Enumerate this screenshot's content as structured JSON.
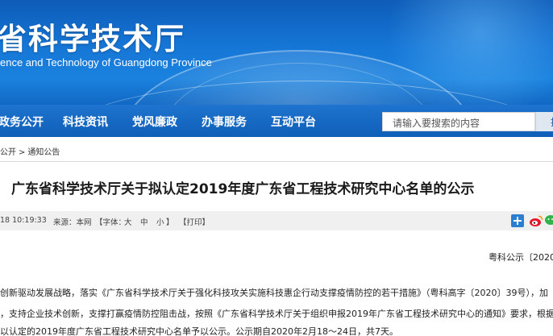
{
  "header": {
    "title": "省科学技术厅",
    "subtitle": "ence and Technology of Guangdong Province"
  },
  "nav": {
    "items": [
      "政务公开",
      "科技资讯",
      "党风廉政",
      "办事服务",
      "互动平台"
    ],
    "search_placeholder": "请输入要搜索的内容",
    "search_button": "搜"
  },
  "breadcrumb": {
    "parent": "公开",
    "separator": ">",
    "current": "通知公告"
  },
  "article": {
    "title": "广东省科学技术厅关于拟认定2019年度广东省工程技术研究中心名单的公示",
    "meta": {
      "date": "18 10:19:33",
      "source": "来源：本网",
      "font_label": "【字体：",
      "font_large": "大",
      "font_medium": "中",
      "font_small": "小",
      "font_close": "】",
      "print": "【打印】"
    },
    "doc_number": "粤科公示〔2020",
    "paragraphs": [
      "创新驱动发展战略，落实《广东省科学技术厅关于强化科技攻关实施科技惠企行动支撑疫情防控的若干措施》（粤科高字〔2020〕39号），加",
      "，支持企业技术创新，支撑打赢疫情防控阻击战，按照《广东省科学技术厅关于组织申报2019年广东省工程技术研究中心的通知》要求，根据",
      "以认定的2019年度广东省工程技术研究中心名单予以公示。公示期自2020年2月18～24日，共7天。"
    ]
  },
  "share": {
    "icons": [
      "add-share-icon",
      "weibo-icon",
      "wechat-icon"
    ]
  },
  "colors": {
    "banner": "#1676d6",
    "nav": "#0f5fb7",
    "meta_bar": "#f0f0f0"
  }
}
